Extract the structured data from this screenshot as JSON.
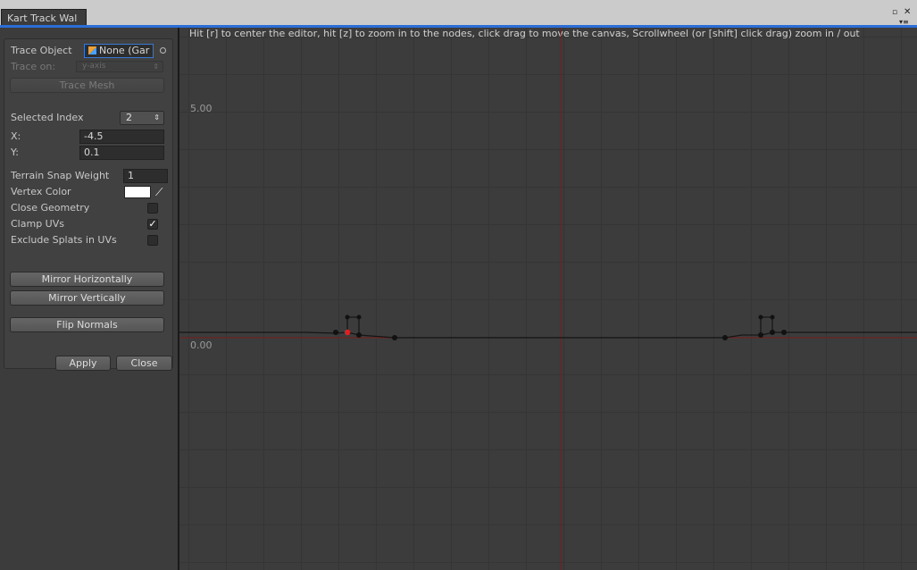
{
  "tab": {
    "title": "Kart Track Wal"
  },
  "window_controls": {
    "maximize_icon": "window-maximize-icon",
    "close_icon": "window-close-icon",
    "menu_icon": "context-menu-icon"
  },
  "panel": {
    "trace_object": {
      "label": "Trace Object",
      "value": "None (Gar",
      "icon": "gameobject-cube-icon"
    },
    "trace_on": {
      "label": "Trace on:",
      "value": "y-axis"
    },
    "trace_mesh_button": "Trace Mesh",
    "selected_index": {
      "label": "Selected Index",
      "value": "2"
    },
    "x": {
      "label": "X:",
      "value": "-4.5"
    },
    "y": {
      "label": "Y:",
      "value": "0.1"
    },
    "terrain_snap_weight": {
      "label": "Terrain Snap Weight",
      "value": "1"
    },
    "vertex_color": {
      "label": "Vertex Color",
      "value": "#ffffff"
    },
    "close_geometry": {
      "label": "Close Geometry",
      "checked": false
    },
    "clamp_uvs": {
      "label": "Clamp UVs",
      "checked": true
    },
    "exclude_splats": {
      "label": "Exclude Splats in UVs",
      "checked": false
    },
    "mirror_horizontally": "Mirror Horizontally",
    "mirror_vertically": "Mirror Vertically",
    "flip_normals": "Flip Normals",
    "apply": "Apply",
    "close": "Close"
  },
  "canvas": {
    "hint": "Hit [r] to center the editor, hit [z] to zoom in to the nodes, click drag to move the canvas, Scrollwheel (or [shift] click drag) zoom in / out",
    "y_label_top": "5.00",
    "y_label_zero": "0.00",
    "selected_node_color": "#e02020",
    "axis_color": "#8a1f1f"
  }
}
